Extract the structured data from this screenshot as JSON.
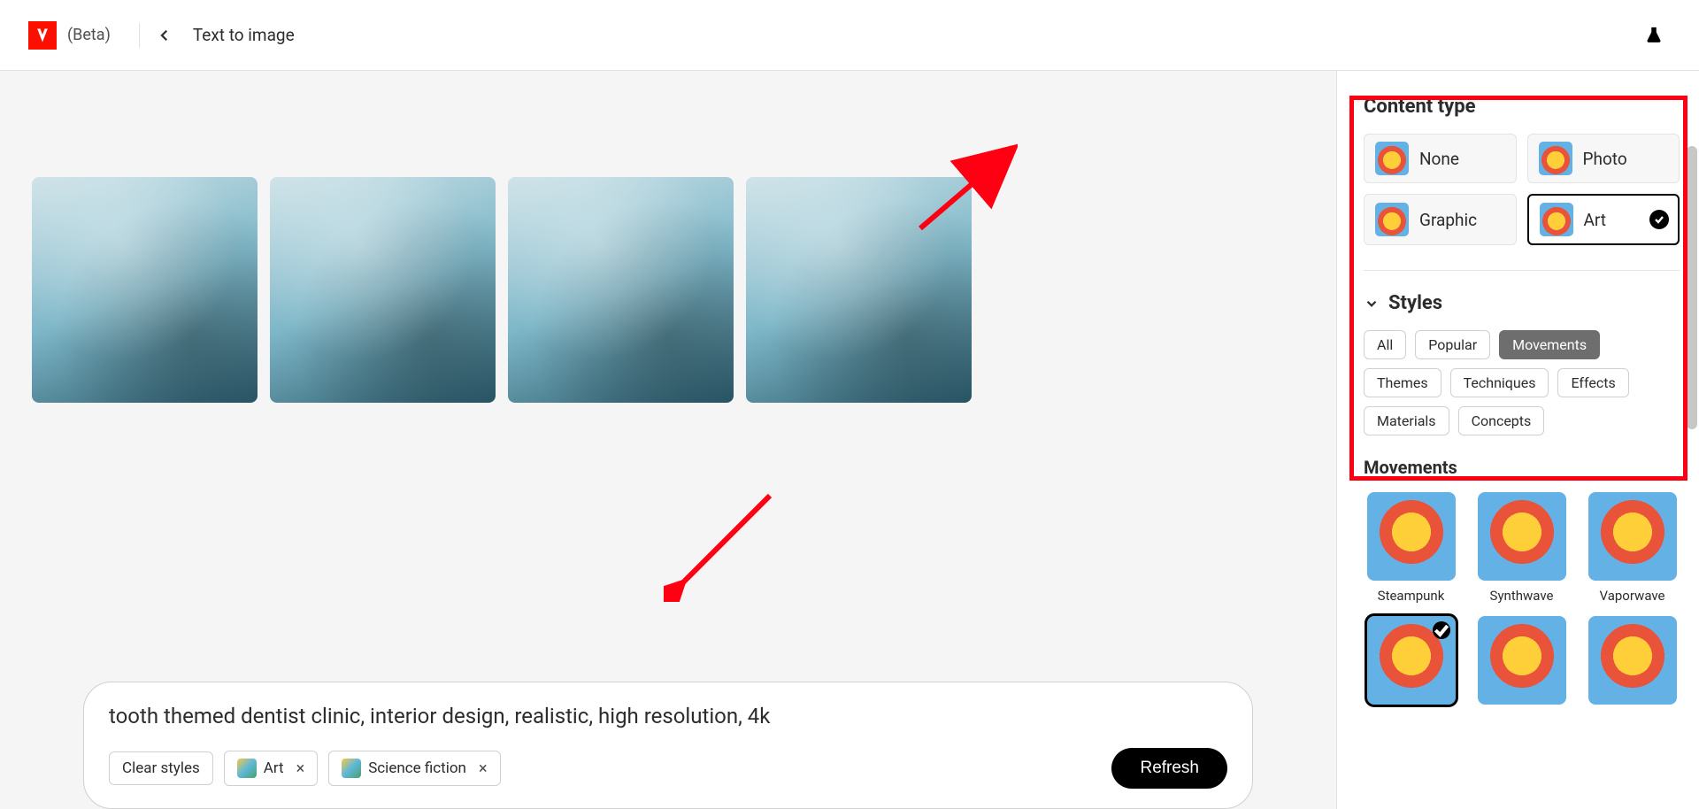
{
  "header": {
    "beta_label": "(Beta)",
    "title": "Text to image"
  },
  "prompt": {
    "text": "tooth themed dentist clinic, interior design, realistic, high resolution, 4k",
    "clear_styles_label": "Clear styles",
    "chips": [
      {
        "label": "Art"
      },
      {
        "label": "Science fiction"
      }
    ],
    "refresh_label": "Refresh"
  },
  "panel": {
    "content_type_title": "Content type",
    "content_types": [
      {
        "label": "None",
        "selected": false
      },
      {
        "label": "Photo",
        "selected": false
      },
      {
        "label": "Graphic",
        "selected": false
      },
      {
        "label": "Art",
        "selected": true
      }
    ],
    "styles_title": "Styles",
    "filters": [
      {
        "label": "All",
        "active": false
      },
      {
        "label": "Popular",
        "active": false
      },
      {
        "label": "Movements",
        "active": true
      },
      {
        "label": "Themes",
        "active": false
      },
      {
        "label": "Techniques",
        "active": false
      },
      {
        "label": "Effects",
        "active": false
      },
      {
        "label": "Materials",
        "active": false
      },
      {
        "label": "Concepts",
        "active": false
      }
    ],
    "subsection_title": "Movements",
    "styles": [
      {
        "label": "Steampunk",
        "selected": false
      },
      {
        "label": "Synthwave",
        "selected": false
      },
      {
        "label": "Vaporwave",
        "selected": false
      },
      {
        "label": "",
        "selected": true
      },
      {
        "label": "",
        "selected": false
      },
      {
        "label": "",
        "selected": false
      }
    ]
  }
}
